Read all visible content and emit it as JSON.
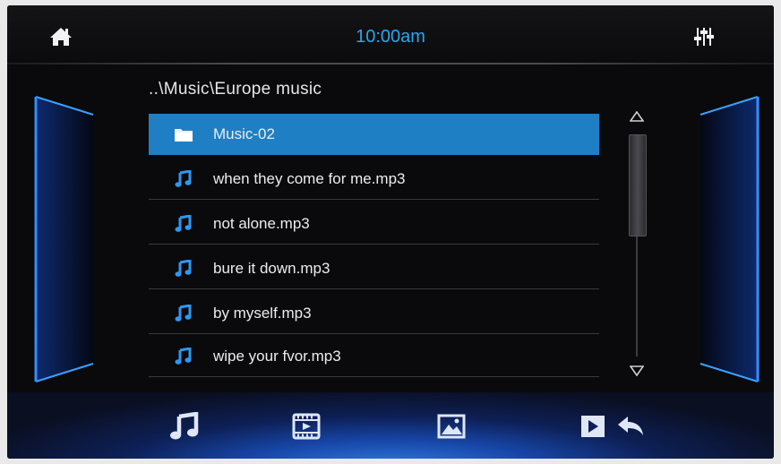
{
  "status_bar": {
    "time": "10:00am"
  },
  "browser": {
    "path": "..\\Music\\Europe music",
    "items": [
      {
        "label": "Music-02",
        "type": "folder",
        "selected": true
      },
      {
        "label": "when they come for me.mp3",
        "type": "music-file"
      },
      {
        "label": "not alone.mp3",
        "type": "music-file"
      },
      {
        "label": "bure it down.mp3",
        "type": "music-file"
      },
      {
        "label": "by myself.mp3",
        "type": "music-file"
      },
      {
        "label": "wipe your fvor.mp3",
        "type": "music-file"
      }
    ]
  },
  "icons": {
    "home": "home-icon",
    "equalizer": "equalizer-icon",
    "music": "music-note-icon",
    "video": "film-icon",
    "photo": "image-icon",
    "play": "play-icon",
    "back": "back-arrow-icon"
  },
  "colors": {
    "accent": "#27a7ee",
    "selection": "#1f7fc4",
    "glow": "#2f7fe0"
  }
}
